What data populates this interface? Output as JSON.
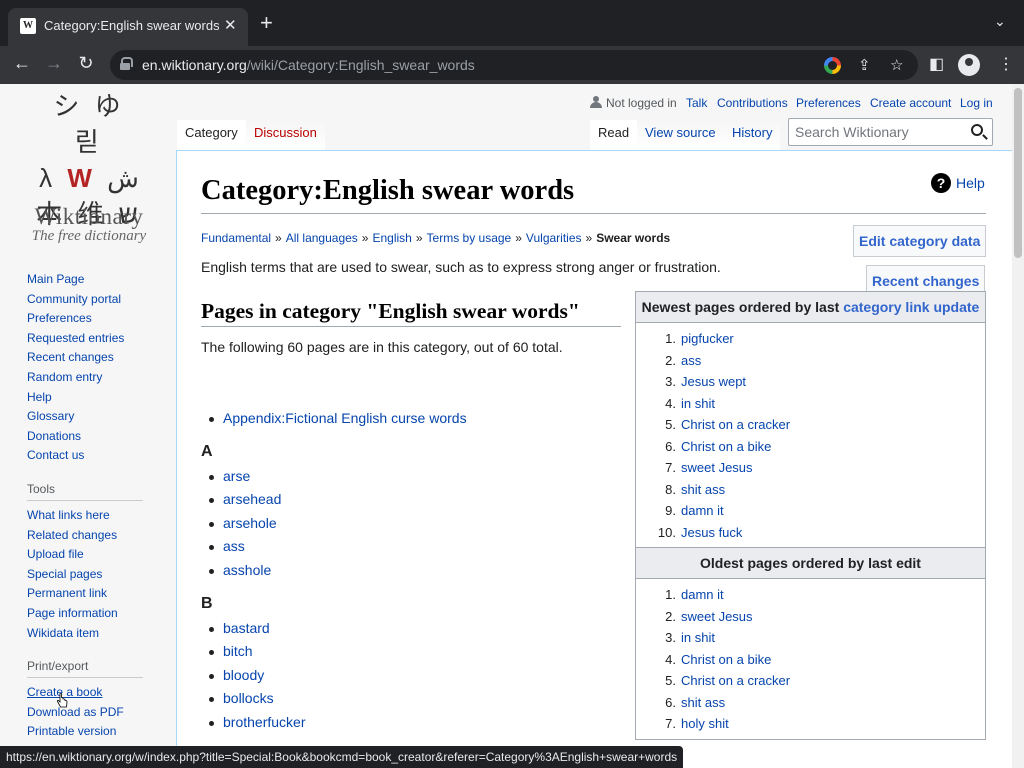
{
  "browser": {
    "tab_title": "Category:English swear words",
    "url_host": "en.wiktionary.org",
    "url_path": "/wiki/Category:English_swear_words",
    "status_url": "https://en.wiktionary.org/w/index.php?title=Special:Book&bookcmd=book_creator&referer=Category%3AEnglish+swear+words"
  },
  "logo": {
    "wordmark": "Wiktionary",
    "tagline": "The free dictionary"
  },
  "sidebar": {
    "nav": [
      "Main Page",
      "Community portal",
      "Preferences",
      "Requested entries",
      "Recent changes",
      "Random entry",
      "Help",
      "Glossary",
      "Donations",
      "Contact us"
    ],
    "tools_heading": "Tools",
    "tools": [
      "What links here",
      "Related changes",
      "Upload file",
      "Special pages",
      "Permanent link",
      "Page information",
      "Wikidata item"
    ],
    "print_heading": "Print/export",
    "print": [
      "Create a book",
      "Download as PDF",
      "Printable version"
    ]
  },
  "personal": {
    "not_logged_in": "Not logged in",
    "talk": "Talk",
    "contributions": "Contributions",
    "preferences": "Preferences",
    "create_account": "Create account",
    "log_in": "Log in"
  },
  "tabs": {
    "category": "Category",
    "discussion": "Discussion",
    "read": "Read",
    "view_source": "View source",
    "history": "History"
  },
  "search": {
    "placeholder": "Search Wiktionary"
  },
  "page": {
    "title": "Category:English swear words",
    "help": "Help",
    "breadcrumbs": [
      "Fundamental",
      "All languages",
      "English",
      "Terms by usage",
      "Vulgarities"
    ],
    "breadcrumb_current": "Swear words",
    "edit_category": "Edit category data",
    "recent_changes": "Recent changes",
    "description": "English terms that are used to swear, such as to express strong anger or frustration.",
    "pages_heading": "Pages in category \"English swear words\"",
    "pages_summary": "The following 60 pages are in this category, out of 60 total.",
    "appendix": "Appendix:Fictional English curse words",
    "groups": [
      {
        "letter": "A",
        "items": [
          "arse",
          "arsehead",
          "arsehole",
          "ass",
          "asshole"
        ]
      },
      {
        "letter": "B",
        "items": [
          "bastard",
          "bitch",
          "bloody",
          "bollocks",
          "brotherfucker"
        ]
      }
    ]
  },
  "newest": {
    "heading": "Newest pages ordered by last",
    "heading_link": "category link update",
    "items": [
      "pigfucker",
      "ass",
      "Jesus wept",
      "in shit",
      "Christ on a cracker",
      "Christ on a bike",
      "sweet Jesus",
      "shit ass",
      "damn it",
      "Jesus fuck"
    ]
  },
  "oldest": {
    "heading": "Oldest pages ordered by last edit",
    "items": [
      "damn it",
      "sweet Jesus",
      "in shit",
      "Christ on a bike",
      "Christ on a cracker",
      "shit ass",
      "holy shit"
    ]
  }
}
